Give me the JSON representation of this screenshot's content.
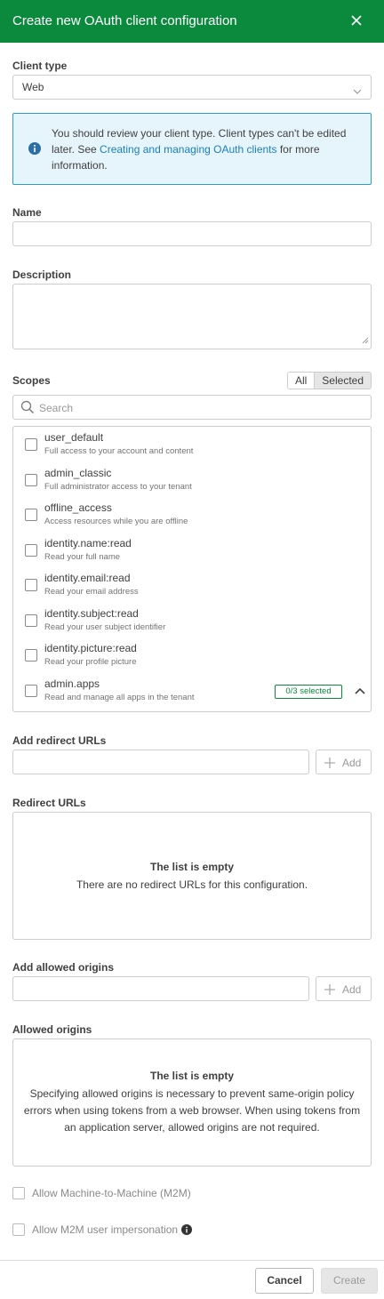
{
  "header": {
    "title": "Create new OAuth client configuration"
  },
  "client_type": {
    "label": "Client type",
    "value": "Web"
  },
  "info": {
    "text_before": "You should review your client type. Client types can't be edited later. See ",
    "link": "Creating and managing OAuth clients",
    "text_after": " for more information."
  },
  "name": {
    "label": "Name",
    "value": ""
  },
  "description": {
    "label": "Description",
    "value": ""
  },
  "scopes": {
    "label": "Scopes",
    "toggle_all": "All",
    "toggle_selected": "Selected",
    "search_placeholder": "Search",
    "items": [
      {
        "name": "user_default",
        "desc": "Full access to your account and content",
        "checked": false
      },
      {
        "name": "admin_classic",
        "desc": "Full administrator access to your tenant",
        "checked": false
      },
      {
        "name": "offline_access",
        "desc": "Access resources while you are offline",
        "checked": false
      },
      {
        "name": "identity.name:read",
        "desc": "Read your full name",
        "checked": false
      },
      {
        "name": "identity.email:read",
        "desc": "Read your email address",
        "checked": false
      },
      {
        "name": "identity.subject:read",
        "desc": "Read your user subject identifier",
        "checked": false
      },
      {
        "name": "identity.picture:read",
        "desc": "Read your profile picture",
        "checked": false
      },
      {
        "name": "admin.apps",
        "desc": "Read and manage all apps in the tenant",
        "checked": false,
        "badge": "0/3 selected"
      }
    ]
  },
  "redirect": {
    "add_label": "Add redirect URLs",
    "add_button": "Add",
    "list_label": "Redirect URLs",
    "empty_title": "The list is empty",
    "empty_text": "There are no redirect URLs for this configuration."
  },
  "origins": {
    "add_label": "Add allowed origins",
    "add_button": "Add",
    "list_label": "Allowed origins",
    "empty_title": "The list is empty",
    "empty_text": "Specifying allowed origins is necessary to prevent same-origin policy errors when using tokens from a web browser. When using tokens from an application server, allowed origins are not required."
  },
  "options": {
    "m2m": "Allow Machine-to-Machine (M2M)",
    "m2m_impersonation": "Allow M2M user impersonation"
  },
  "footer": {
    "cancel": "Cancel",
    "create": "Create"
  },
  "colors": {
    "header": "#0b8a3e",
    "link": "#1a7fc1",
    "info_bg": "#e6f4fb",
    "info_border": "#2d9bd5"
  }
}
